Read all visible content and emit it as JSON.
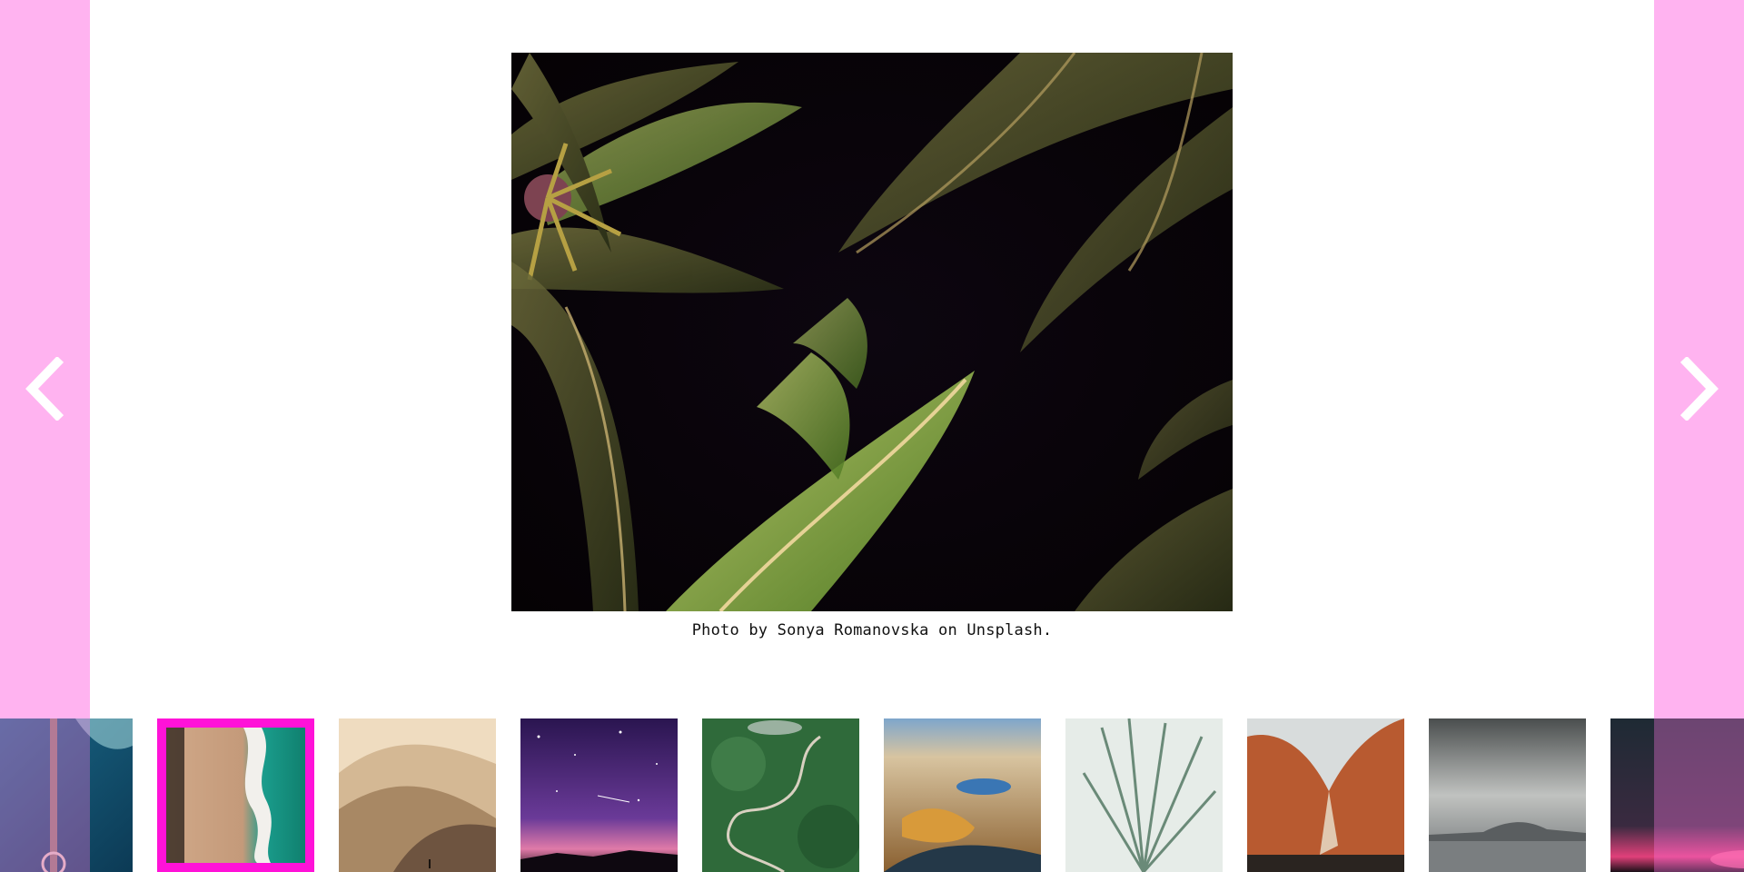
{
  "gallery": {
    "caption": "Photo by Sonya Romanovska on Unsplash.",
    "main_photo_subject": "palm-fronds-at-night",
    "accent_color": "#ff12d8",
    "side_panel_color": "#ffb3f0",
    "prev_icon": "chevron-left-icon",
    "next_icon": "chevron-right-icon",
    "active_thumbnail_index": 1,
    "thumbnails": [
      {
        "subject": "aerial-ocean-pier"
      },
      {
        "subject": "aerial-beach-waves"
      },
      {
        "subject": "sand-dunes"
      },
      {
        "subject": "starry-night-sky"
      },
      {
        "subject": "winding-forest-road"
      },
      {
        "subject": "wetland-river-autumn"
      },
      {
        "subject": "frosted-pine-needles"
      },
      {
        "subject": "red-rock-canyon"
      },
      {
        "subject": "misty-sea-mountain"
      },
      {
        "subject": "pink-sunset-coast"
      }
    ]
  }
}
